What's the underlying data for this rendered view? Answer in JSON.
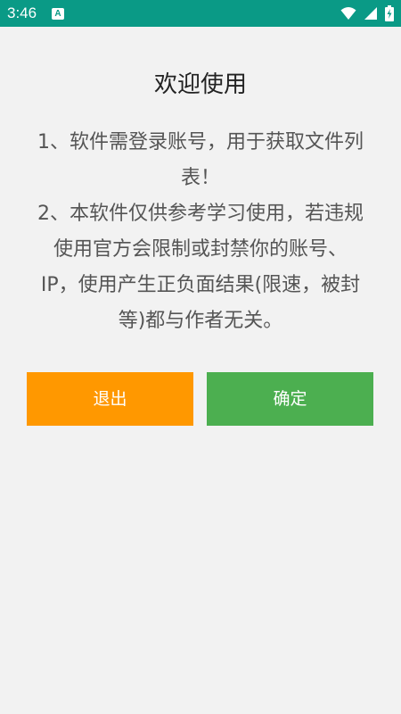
{
  "status_bar": {
    "time": "3:46",
    "notification_glyph": "A",
    "icons": [
      "wifi-icon",
      "signal-icon",
      "battery-charging-icon"
    ],
    "color": "#0a9a86"
  },
  "dialog": {
    "title": "欢迎使用",
    "notice_line1": "1、软件需登录账号，用于获取文件列表！",
    "notice_line2": "2、本软件仅供参考学习使用，若违规使用官方会限制或封禁你的账号、IP，使用产生正负面结果(限速，被封等)都与作者无关。"
  },
  "buttons": {
    "exit_label": "退出",
    "exit_color": "#ff9800",
    "confirm_label": "确定",
    "confirm_color": "#4caf50"
  }
}
